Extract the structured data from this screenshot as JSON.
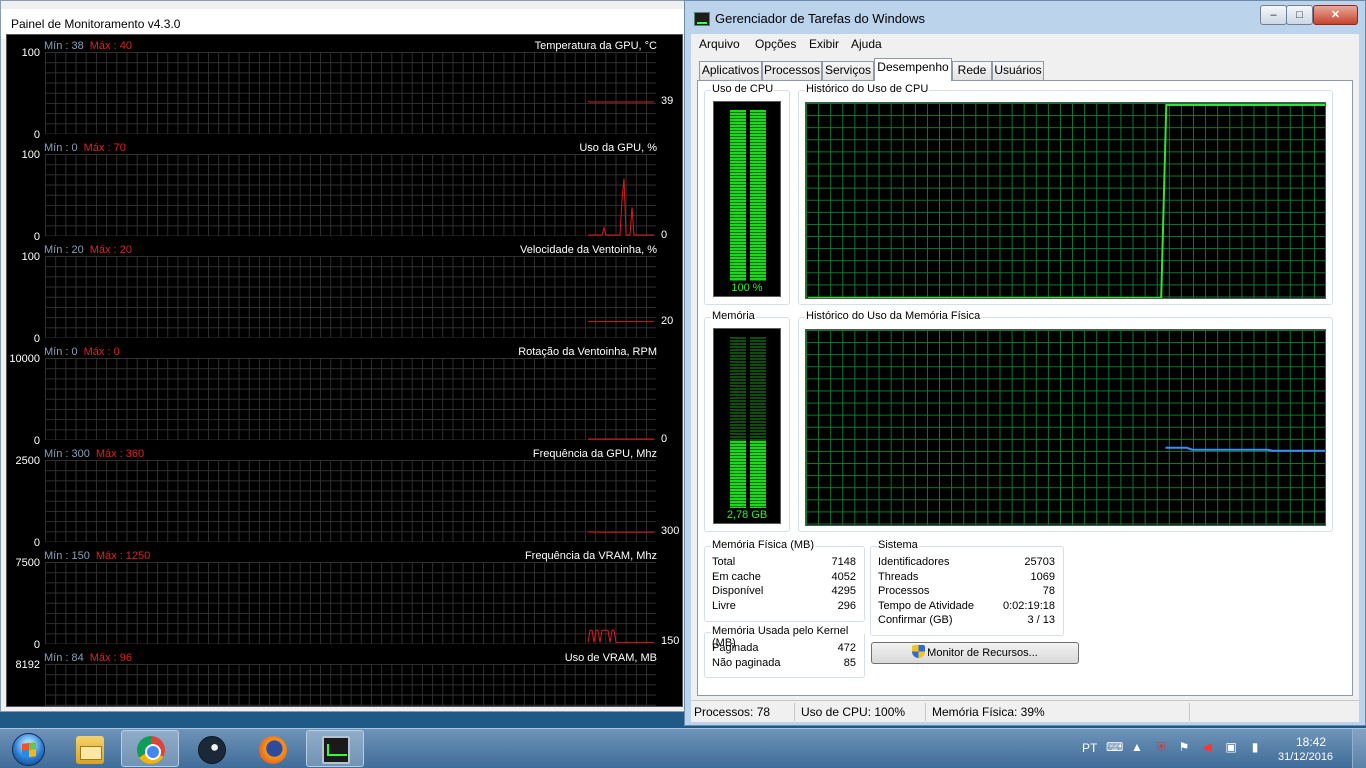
{
  "monitor": {
    "title": "Painel de Monitoramento v4.3.0",
    "panels": [
      {
        "label": "Temperatura da GPU, °C",
        "min_text": "Mín : 38",
        "max_text": "Máx : 40",
        "ymax": "100",
        "ymin": "0",
        "current": "39",
        "current_value": 39,
        "scale_max": 100,
        "trace": [
          40,
          39,
          39,
          39,
          39,
          39,
          39,
          39,
          39,
          39,
          39,
          39,
          39,
          39,
          39,
          39,
          39,
          39,
          39,
          39,
          39,
          39,
          39,
          39,
          39,
          39,
          39,
          39,
          39,
          39,
          39,
          39,
          39,
          39
        ]
      },
      {
        "label": "Uso da GPU, %",
        "min_text": "Mín : 0",
        "max_text": "Máx : 70",
        "ymax": "100",
        "ymin": "0",
        "current": "0",
        "current_value": 0,
        "scale_max": 100,
        "trace": [
          0,
          0,
          0,
          0,
          0,
          0,
          0,
          0,
          10,
          0,
          0,
          0,
          0,
          0,
          0,
          0,
          0,
          45,
          70,
          0,
          0,
          0,
          35,
          0,
          0,
          0,
          0,
          0,
          0,
          0,
          0,
          0,
          0,
          0
        ]
      },
      {
        "label": "Velocidade da Ventoinha, %",
        "min_text": "Mín : 20",
        "max_text": "Máx : 20",
        "ymax": "100",
        "ymin": "0",
        "current": "20",
        "current_value": 20,
        "scale_max": 100,
        "trace": [
          20,
          20,
          20,
          20,
          20,
          20,
          20,
          20,
          20,
          20,
          20,
          20,
          20,
          20,
          20,
          20,
          20,
          20,
          20,
          20,
          20,
          20,
          20,
          20,
          20,
          20,
          20,
          20,
          20,
          20,
          20,
          20,
          20,
          20
        ]
      },
      {
        "label": "Rotação da Ventoinha, RPM",
        "min_text": "Mín : 0",
        "max_text": "Máx : 0",
        "ymax": "10000",
        "ymin": "0",
        "current": "0",
        "current_value": 0,
        "scale_max": 10000,
        "trace": [
          0,
          0,
          0,
          0,
          0,
          0,
          0,
          0,
          0,
          0,
          0,
          0,
          0,
          0,
          0,
          0,
          0,
          0,
          0,
          0,
          0,
          0,
          0,
          0,
          0,
          0,
          0,
          0,
          0,
          0,
          0,
          0,
          0,
          0
        ]
      },
      {
        "label": "Frequência da GPU, Mhz",
        "min_text": "Mín : 300",
        "max_text": "Máx : 360",
        "ymax": "2500",
        "ymin": "0",
        "current": "300",
        "current_value": 300,
        "scale_max": 2500,
        "trace": [
          310,
          300,
          310,
          300,
          300,
          310,
          300,
          300,
          300,
          300,
          300,
          300,
          300,
          300,
          300,
          300,
          300,
          300,
          300,
          300,
          300,
          300,
          300,
          300,
          300,
          300,
          300,
          300,
          300,
          300,
          300,
          300,
          300,
          300
        ]
      },
      {
        "label": "Frequência da VRAM, Mhz",
        "min_text": "Mín : 150",
        "max_text": "Máx : 1250",
        "ymax": "7500",
        "ymin": "0",
        "current": "150",
        "current_value": 150,
        "scale_max": 7500,
        "trace": [
          150,
          1250,
          1250,
          150,
          1250,
          1250,
          150,
          1250,
          1250,
          1250,
          1250,
          150,
          1250,
          1250,
          150,
          150,
          150,
          150,
          150,
          150,
          150,
          150,
          150,
          150,
          150,
          150,
          150,
          150,
          150,
          150,
          150,
          150,
          150,
          150
        ]
      },
      {
        "label": "Uso de VRAM, MB",
        "min_text": "Mín : 84",
        "max_text": "Máx : 96",
        "ymax": "8192",
        "ymin": "",
        "current": "",
        "current_value": null,
        "scale_max": 8192,
        "trace": []
      }
    ]
  },
  "taskmgr": {
    "title": "Gerenciador de Tarefas do Windows",
    "caption_buttons": {
      "minimize": "–",
      "maximize": "□",
      "close": "✕"
    },
    "menu": [
      "Arquivo",
      "Opções",
      "Exibir",
      "Ajuda"
    ],
    "tabs": [
      "Aplicativos",
      "Processos",
      "Serviços",
      "Desempenho",
      "Rede",
      "Usuários"
    ],
    "active_tab": "Desempenho",
    "cpu_usage_title": "Uso de CPU",
    "cpu_usage_value": "100 %",
    "cpu_usage_fraction": 1.0,
    "cpu_history_title": "Histórico do Uso de CPU",
    "cpu_history": [
      0,
      0,
      0,
      0,
      0,
      0,
      0,
      0,
      0,
      0,
      0,
      0,
      0,
      0,
      0,
      0,
      0,
      0,
      0,
      0,
      0,
      0,
      0,
      0,
      0,
      0,
      0,
      0,
      0,
      0,
      0,
      0,
      0,
      0,
      0,
      0,
      0,
      0,
      0,
      0,
      0,
      0,
      0,
      0,
      0,
      0,
      0,
      0,
      0,
      0,
      0,
      0,
      0,
      0,
      0,
      0,
      0,
      0,
      0,
      0,
      0,
      0,
      0,
      0,
      0,
      0,
      0,
      0,
      0,
      0,
      100,
      100,
      100,
      100,
      100,
      100,
      100,
      100,
      100,
      100,
      100,
      100,
      100,
      100,
      100,
      100,
      100,
      100,
      100,
      100,
      100,
      100,
      100,
      100,
      100,
      100,
      100,
      100,
      100,
      100,
      100,
      100
    ],
    "memory_title": "Memória",
    "memory_value": "2,78 GB",
    "memory_fraction": 0.39,
    "memory_history_title": "Histórico do Uso da Memória Física",
    "memory_history": [
      0.4,
      0.4,
      0.4,
      0.4,
      0.4,
      0.39,
      0.39,
      0.39,
      0.39,
      0.39,
      0.39,
      0.39,
      0.39,
      0.39,
      0.39,
      0.39,
      0.39,
      0.39,
      0.39,
      0.39,
      0.385,
      0.385,
      0.385,
      0.385,
      0.385,
      0.385,
      0.385,
      0.385,
      0.385,
      0.385,
      0.385
    ],
    "physical_memory": {
      "title": "Memória Física (MB)",
      "rows": [
        {
          "k": "Total",
          "v": "7148"
        },
        {
          "k": "Em cache",
          "v": "4052"
        },
        {
          "k": "Disponível",
          "v": "4295"
        },
        {
          "k": "Livre",
          "v": "296"
        }
      ]
    },
    "kernel_memory": {
      "title": "Memória Usada pelo Kernel (MB)",
      "rows": [
        {
          "k": "Paginada",
          "v": "472"
        },
        {
          "k": "Não paginada",
          "v": "85"
        }
      ]
    },
    "system": {
      "title": "Sistema",
      "rows": [
        {
          "k": "Identificadores",
          "v": "25703"
        },
        {
          "k": "Threads",
          "v": "1069"
        },
        {
          "k": "Processos",
          "v": "78"
        },
        {
          "k": "Tempo de Atividade",
          "v": "0:02:19:18"
        },
        {
          "k": "Confirmar (GB)",
          "v": "3 / 13"
        }
      ]
    },
    "resource_monitor_button": "Monitor de Recursos...",
    "status": {
      "processes": "Processos: 78",
      "cpu": "Uso de CPU: 100%",
      "memory": "Memória Física: 39%"
    }
  },
  "taskbar": {
    "apps": [
      {
        "name": "explorer",
        "active": false
      },
      {
        "name": "chrome",
        "active": true
      },
      {
        "name": "steam",
        "active": false
      },
      {
        "name": "firefox",
        "active": false
      },
      {
        "name": "taskmgr",
        "active": true
      }
    ],
    "language": "PT",
    "tray_icons": [
      "show-hidden-icons",
      "antivirus-icon",
      "action-center-flag-icon",
      "volume-icon",
      "network-icon",
      "power-icon"
    ],
    "clock_time": "18:42",
    "clock_date": "31/12/2016"
  }
}
